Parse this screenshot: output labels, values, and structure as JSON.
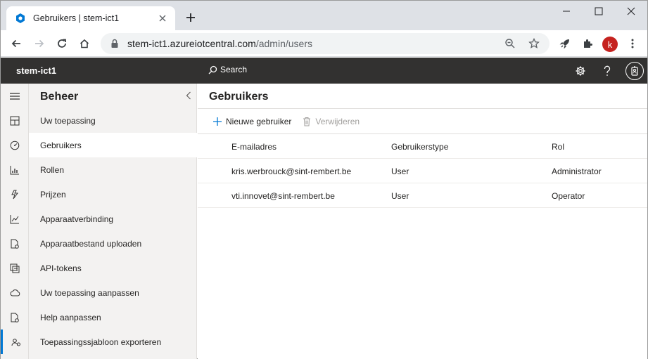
{
  "browser": {
    "tab_title": "Gebruikers | stem-ict1",
    "url_host": "stem-ict1.azureiotcentral.com",
    "url_path": "/admin/users",
    "profile_initial": "k",
    "profile_color": "#c5221f"
  },
  "app": {
    "name": "stem-ict1",
    "search_label": "Search",
    "accent_color": "#0078d4"
  },
  "rail": {
    "icons": [
      "hamburger-icon",
      "dashboard-icon",
      "gauge-icon",
      "devices-icon",
      "rules-icon",
      "analytics-icon",
      "jobs-icon",
      "templates-icon",
      "data-export-icon",
      "files-icon",
      "admin-icon"
    ]
  },
  "subnav": {
    "title": "Beheer",
    "items": [
      {
        "label": "Uw toepassing"
      },
      {
        "label": "Gebruikers"
      },
      {
        "label": "Rollen"
      },
      {
        "label": "Prijzen"
      },
      {
        "label": "Apparaatverbinding"
      },
      {
        "label": "Apparaatbestand uploaden"
      },
      {
        "label": "API-tokens"
      },
      {
        "label": "Uw toepassing aanpassen"
      },
      {
        "label": "Help aanpassen"
      },
      {
        "label": "Toepassingssjabloon exporteren"
      }
    ],
    "active_index": 1
  },
  "main": {
    "title": "Gebruikers",
    "commands": {
      "new_user": "Nieuwe gebruiker",
      "delete": "Verwijderen"
    },
    "columns": [
      "E-mailadres",
      "Gebruikerstype",
      "Rol"
    ],
    "rows": [
      [
        "kris.werbrouck@sint-rembert.be",
        "User",
        "Administrator"
      ],
      [
        "vti.innovet@sint-rembert.be",
        "User",
        "Operator"
      ]
    ]
  }
}
